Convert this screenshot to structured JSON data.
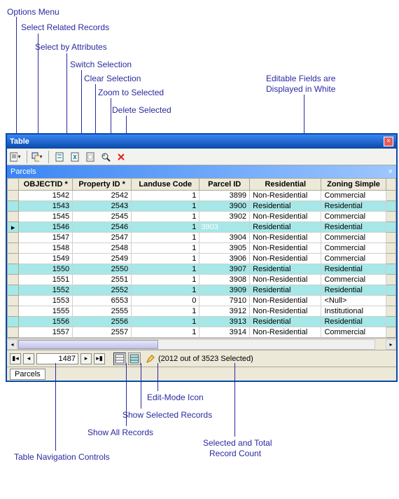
{
  "callouts": {
    "options_menu": "Options Menu",
    "select_related": "Select Related Records",
    "select_by_attr": "Select by Attributes",
    "switch_selection": "Switch Selection",
    "clear_selection": "Clear Selection",
    "zoom_to_selected": "Zoom to Selected",
    "delete_selected": "Delete Selected",
    "editable_fields": "Editable Fields are",
    "editable_fields2": "Displayed in White",
    "edit_mode_icon": "Edit-Mode Icon",
    "show_selected": "Show Selected Records",
    "show_all": "Show All Records",
    "nav_controls": "Table Navigation Controls",
    "sel_count1": "Selected and Total",
    "sel_count2": "Record Count"
  },
  "window": {
    "title": "Table",
    "subheader": "Parcels",
    "tab": "Parcels",
    "nav_value": "1487",
    "status": "(2012 out of 3523 Selected)"
  },
  "columns": [
    "OBJECTID *",
    "Property ID *",
    "Landuse Code",
    "Parcel ID",
    "Residential",
    "Zoning Simple"
  ],
  "editing_value": "3903",
  "rows": [
    {
      "sel": false,
      "ptr": false,
      "vals": [
        "1542",
        "2542",
        "1",
        "3899",
        "Non-Residential",
        "Commercial"
      ]
    },
    {
      "sel": true,
      "ptr": false,
      "vals": [
        "1543",
        "2543",
        "1",
        "3900",
        "Residential",
        "Residential"
      ]
    },
    {
      "sel": false,
      "ptr": false,
      "vals": [
        "1545",
        "2545",
        "1",
        "3902",
        "Non-Residential",
        "Commercial"
      ]
    },
    {
      "sel": true,
      "ptr": true,
      "vals": [
        "1546",
        "2546",
        "1",
        "",
        "Residential",
        "Residential"
      ],
      "editing_col": 3
    },
    {
      "sel": false,
      "ptr": false,
      "vals": [
        "1547",
        "2547",
        "1",
        "3904",
        "Non-Residential",
        "Commercial"
      ]
    },
    {
      "sel": false,
      "ptr": false,
      "vals": [
        "1548",
        "2548",
        "1",
        "3905",
        "Non-Residential",
        "Commercial"
      ]
    },
    {
      "sel": false,
      "ptr": false,
      "vals": [
        "1549",
        "2549",
        "1",
        "3906",
        "Non-Residential",
        "Commercial"
      ]
    },
    {
      "sel": true,
      "ptr": false,
      "vals": [
        "1550",
        "2550",
        "1",
        "3907",
        "Residential",
        "Residential"
      ]
    },
    {
      "sel": false,
      "ptr": false,
      "vals": [
        "1551",
        "2551",
        "1",
        "3908",
        "Non-Residential",
        "Commercial"
      ]
    },
    {
      "sel": true,
      "ptr": false,
      "vals": [
        "1552",
        "2552",
        "1",
        "3909",
        "Residential",
        "Residential"
      ]
    },
    {
      "sel": false,
      "ptr": false,
      "vals": [
        "1553",
        "6553",
        "0",
        "7910",
        "Non-Residential",
        "<Null>"
      ]
    },
    {
      "sel": false,
      "ptr": false,
      "vals": [
        "1555",
        "2555",
        "1",
        "3912",
        "Non-Residential",
        "Institutional"
      ]
    },
    {
      "sel": true,
      "ptr": false,
      "vals": [
        "1556",
        "2556",
        "1",
        "3913",
        "Residential",
        "Residential"
      ]
    },
    {
      "sel": false,
      "ptr": false,
      "vals": [
        "1557",
        "2557",
        "1",
        "3914",
        "Non-Residential",
        "Commercial"
      ]
    }
  ]
}
